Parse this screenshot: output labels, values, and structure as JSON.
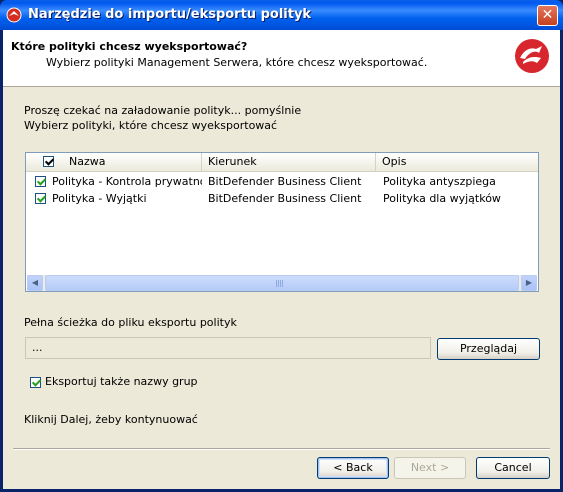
{
  "window": {
    "title": "Narzędzie do importu/eksportu polityk",
    "close_glyph": "✕"
  },
  "header": {
    "title": "Które polityki chcesz wyeksportować?",
    "subtitle": "Wybierz polityki Management Serwera, które chcesz wyeksportować.",
    "logo_icon": "bitdefender-logo-icon"
  },
  "status": {
    "loading": "Proszę czekać na załadowanie polityk... pomyślnie",
    "instruction": "Wybierz polityki, które chcesz wyeksportować"
  },
  "policy_list": {
    "select_all_checked": true,
    "columns": [
      "Nazwa",
      "Kierunek",
      "Opis"
    ],
    "rows": [
      {
        "checked": true,
        "name": "Polityka - Kontrola prywatności",
        "direction": "BitDefender Business Client",
        "description": "Polityka antyszpiega"
      },
      {
        "checked": true,
        "name": "Polityka - Wyjątki",
        "direction": "BitDefender Business Client",
        "description": "Polityka dla wyjątków"
      }
    ]
  },
  "export_path": {
    "label": "Pełna ścieżka do pliku eksportu polityk",
    "value": "...",
    "browse_label": "Przeglądaj"
  },
  "options": {
    "export_group_names_checked": true,
    "export_group_names_label": "Eksportuj także nazwy grup"
  },
  "footer": {
    "hint": "Kliknij Dalej, żeby kontynuować",
    "back_label": "< Back",
    "next_label": "Next >",
    "cancel_label": "Cancel"
  }
}
